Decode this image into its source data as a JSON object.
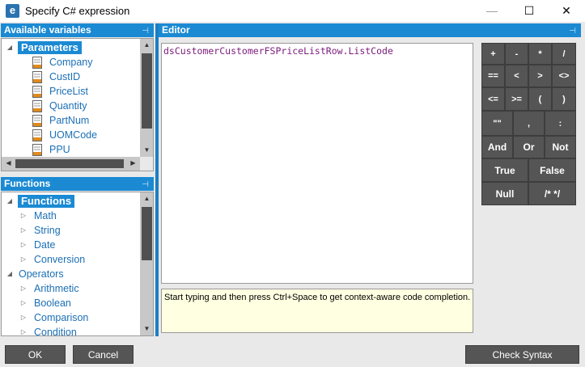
{
  "window": {
    "title": "Specify C# expression",
    "app_icon_letter": "e",
    "minimize_glyph": "—",
    "maximize_glyph": "☐",
    "close_glyph": "✕"
  },
  "panels": {
    "variables_title": "Available variables",
    "functions_title": "Functions",
    "editor_title": "Editor",
    "pin_glyph": "⊣"
  },
  "variables": {
    "root": "Parameters",
    "items": [
      "Company",
      "CustID",
      "PriceList",
      "Quantity",
      "PartNum",
      "UOMCode",
      "PPU"
    ]
  },
  "functions": {
    "root": "Functions",
    "function_items": [
      "Math",
      "String",
      "Date",
      "Conversion"
    ],
    "operators_label": "Operators",
    "operator_items": [
      "Arithmetic",
      "Boolean",
      "Comparison",
      "Condition"
    ]
  },
  "editor": {
    "expression": "dsCustomerCustomerFSPriceListRow.ListCode",
    "hint": "Start typing and then press Ctrl+Space to get context-aware code completion."
  },
  "calculator": {
    "row1": [
      "+",
      "-",
      "*",
      "/"
    ],
    "row2": [
      "==",
      "<",
      ">",
      "<>"
    ],
    "row3": [
      "<=",
      ">=",
      "(",
      ")"
    ],
    "row4": [
      "\"\"",
      ",",
      ":"
    ],
    "row5": [
      "And",
      "Or",
      "Not"
    ],
    "row6": [
      "True",
      "False"
    ],
    "row7": [
      "Null",
      "/* */"
    ]
  },
  "footer": {
    "ok": "OK",
    "cancel": "Cancel",
    "check_syntax": "Check Syntax"
  },
  "colors": {
    "accent": "#1b8ad3",
    "button": "#555555",
    "hint_bg": "#ffffe1"
  }
}
